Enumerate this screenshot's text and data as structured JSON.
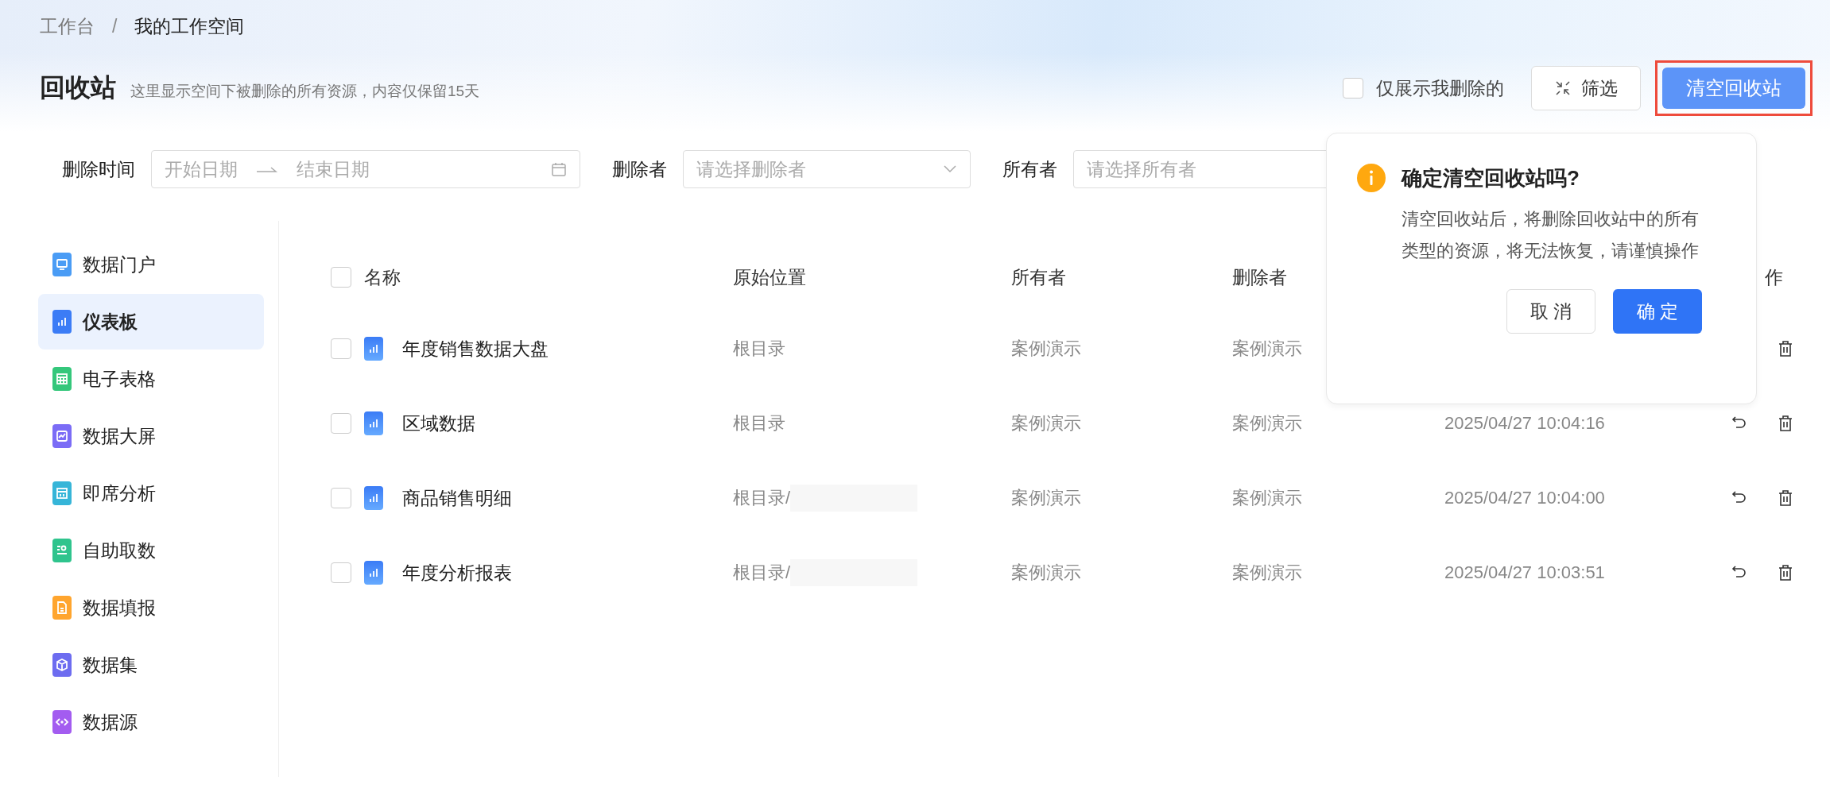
{
  "breadcrumb": {
    "separator": "/",
    "items": [
      {
        "label": "工作台",
        "current": false
      },
      {
        "label": "我的工作空间",
        "current": true
      }
    ]
  },
  "page": {
    "title": "回收站",
    "subtitle": "这里显示空间下被删除的所有资源，内容仅保留15天"
  },
  "toolbar": {
    "only_mine": {
      "label": "仅展示我删除的",
      "checked": false
    },
    "filter_button": "筛选",
    "clear_button": {
      "label": "清空回收站",
      "highlighted": true
    }
  },
  "filters": {
    "delete_time": {
      "label": "删除时间",
      "start_placeholder": "开始日期",
      "end_placeholder": "结束日期"
    },
    "deleter": {
      "label": "删除者",
      "placeholder": "请选择删除者"
    },
    "owner": {
      "label": "所有者",
      "placeholder": "请选择所有者"
    }
  },
  "sidebar": {
    "items": [
      {
        "label": "数据门户",
        "kind": "portal",
        "color": "#4a9cf5",
        "selected": false
      },
      {
        "label": "仪表板",
        "kind": "dashboard",
        "color": "#3b7cf6",
        "selected": true
      },
      {
        "label": "电子表格",
        "kind": "sheet",
        "color": "#34c77b",
        "selected": false
      },
      {
        "label": "数据大屏",
        "kind": "screen",
        "color": "#7b6cf6",
        "selected": false
      },
      {
        "label": "即席分析",
        "kind": "adhoc",
        "color": "#36b5d8",
        "selected": false
      },
      {
        "label": "自助取数",
        "kind": "selfservice",
        "color": "#2fc48d",
        "selected": false
      },
      {
        "label": "数据填报",
        "kind": "form",
        "color": "#ffa52e",
        "selected": false
      },
      {
        "label": "数据集",
        "kind": "dataset",
        "color": "#6d6cf0",
        "selected": false
      },
      {
        "label": "数据源",
        "kind": "datasource",
        "color": "#a35cf0",
        "selected": false
      }
    ]
  },
  "table": {
    "columns": [
      "名称",
      "原始位置",
      "所有者",
      "删除者",
      "作"
    ],
    "select_all_checked": false,
    "rows": [
      {
        "name": "年度销售数据大盘",
        "location": "根目录",
        "owner": "案例演示",
        "deleter": "案例演示",
        "checked": false,
        "redacted": false
      },
      {
        "name": "区域数据",
        "location": "根目录",
        "owner": "案例演示",
        "deleter": "案例演示",
        "deleted_at": "2025/04/27 10:04:16",
        "checked": false,
        "redacted": false
      },
      {
        "name": "商品销售明细",
        "location": "根目录/",
        "owner": "案例演示",
        "deleter": "案例演示",
        "deleted_at": "2025/04/27 10:04:00",
        "checked": false,
        "redacted": true
      },
      {
        "name": "年度分析报表",
        "location": "根目录/",
        "owner": "案例演示",
        "deleter": "案例演示",
        "deleted_at": "2025/04/27 10:03:51",
        "checked": false,
        "redacted": true
      }
    ]
  },
  "popover": {
    "title": "确定清空回收站吗?",
    "message": "清空回收站后，将删除回收站中的所有类型的资源，将无法恢复，请谨慎操作",
    "cancel": "取 消",
    "confirm": "确 定"
  }
}
